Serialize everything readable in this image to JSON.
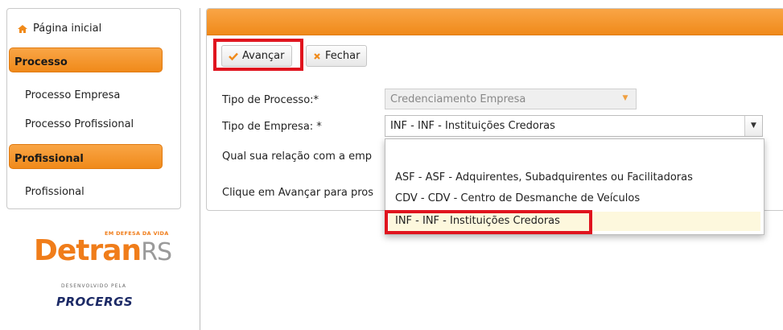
{
  "sidebar": {
    "home_label": "Página inicial",
    "sections": [
      {
        "title": "Processo",
        "items": [
          "Processo Empresa",
          "Processo Profissional"
        ]
      },
      {
        "title": "Profissional",
        "items": [
          "Profissional"
        ]
      }
    ]
  },
  "logos": {
    "detran_tagline": "EM DEFESA DA VIDA",
    "detran_main": "Detran",
    "detran_suffix": "RS",
    "developed_by": "DESENVOLVIDO PELA",
    "procergs": "PROCERGS"
  },
  "toolbar": {
    "advance_label": "Avançar",
    "close_label": "Fechar"
  },
  "form": {
    "tipo_processo_label": "Tipo de Processo:*",
    "tipo_processo_value": "Credenciamento Empresa",
    "tipo_empresa_label": "Tipo de Empresa: *",
    "tipo_empresa_value": "INF - INF - Instituições Credoras",
    "relacao_label": "Qual sua relação com a emp",
    "instruction": "Clique em Avançar para pros"
  },
  "dropdown": {
    "options": [
      "ASF - ASF - Adquirentes, Subadquirentes ou Facilitadoras",
      "CDV - CDV - Centro de Desmanche de Veículos",
      "INF - INF - Instituições Credoras"
    ],
    "selected": "INF - INF - Instituições Credoras"
  },
  "colors": {
    "accent_orange": "#f08a1a",
    "highlight_red": "#e0141e"
  }
}
